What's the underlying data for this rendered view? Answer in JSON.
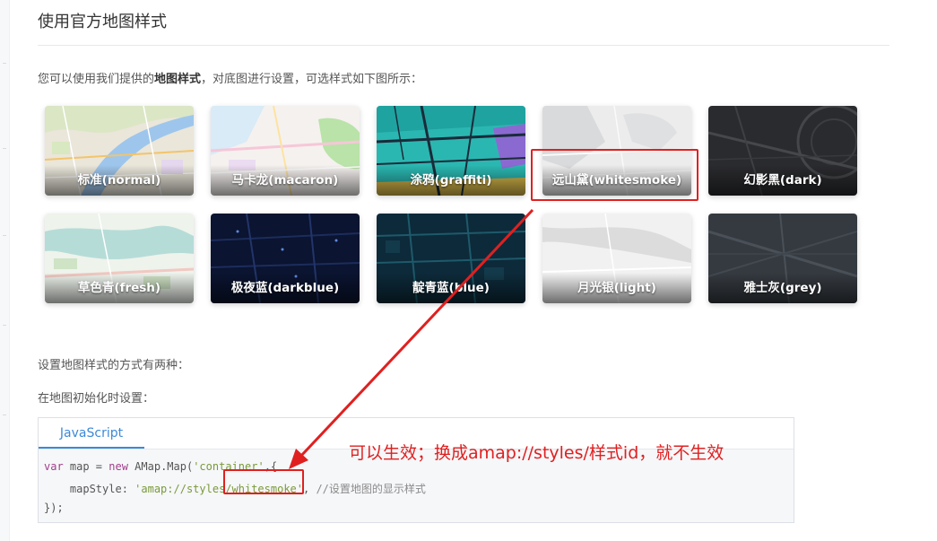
{
  "section": {
    "title": "使用官方地图样式",
    "intro_prefix": "您可以使用我们提供的",
    "intro_bold": "地图样式",
    "intro_suffix": "，对底图进行设置，可选样式如下图所示："
  },
  "styles": [
    {
      "label": "标准(normal)",
      "theme": "normal"
    },
    {
      "label": "马卡龙(macaron)",
      "theme": "macaron"
    },
    {
      "label": "涂鸦(graffiti)",
      "theme": "graffiti"
    },
    {
      "label": "远山黛(whitesmoke)",
      "theme": "whitesmoke"
    },
    {
      "label": "幻影黑(dark)",
      "theme": "dark"
    },
    {
      "label": "草色青(fresh)",
      "theme": "fresh"
    },
    {
      "label": "极夜蓝(darkblue)",
      "theme": "darkblue"
    },
    {
      "label": "靛青蓝(blue)",
      "theme": "blue"
    },
    {
      "label": "月光银(light)",
      "theme": "light"
    },
    {
      "label": "雅士灰(grey)",
      "theme": "grey"
    }
  ],
  "text": {
    "two_ways": "设置地图样式的方式有两种：",
    "init_setting": "在地图初始化时设置："
  },
  "code": {
    "tab": "JavaScript",
    "line1_kw1": "var",
    "line1_a": " map = ",
    "line1_kw2": "new",
    "line1_b": " AMap.Map(",
    "line1_str": "'container'",
    "line1_c": ",{",
    "line2_a": "    mapStyle: ",
    "line2_str": "'amap://styles/whitesmoke'",
    "line2_b": ", ",
    "line2_cmt": "//设置地图的显示样式",
    "line3": "});"
  },
  "annotation": "可以生效；换成amap://styles/样式id，就不生效",
  "colors": {
    "highlight": "#e02020",
    "tab_active": "#3c8ad8"
  }
}
